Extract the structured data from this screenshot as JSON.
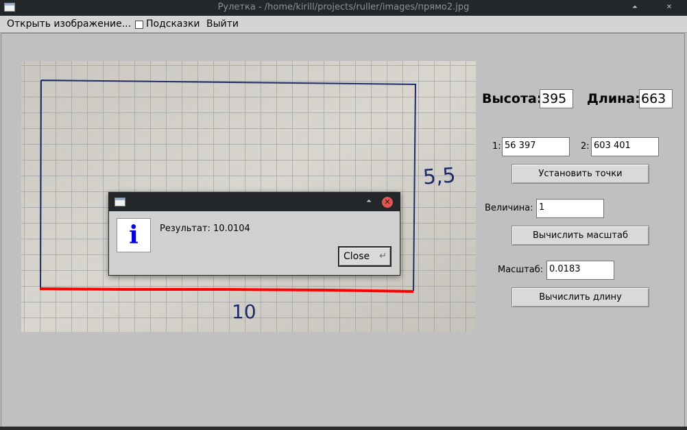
{
  "window": {
    "title": "Рулетка - /home/kirill/projects/ruller/images/прямо2.jpg",
    "maximize_glyph": "⏶",
    "close_glyph": "✕"
  },
  "menubar": {
    "open_image": "Открыть изображение...",
    "hints_label": "Подсказки",
    "hints_checked": false,
    "exit": "Выйти"
  },
  "image_panel": {
    "handwritten_right": "5,5",
    "handwritten_bottom": "10",
    "rect_color": "#1f2a66",
    "measure_line_color": "#ff0000"
  },
  "controls": {
    "height_label": "Высота:",
    "height_value": "395",
    "width_label": "Длина:",
    "width_value": "663",
    "point1_label": "1:",
    "point1_value": "56 397",
    "point2_label": "2:",
    "point2_value": "603 401",
    "set_points_button": "Установить точки",
    "magnitude_label": "Величина:",
    "magnitude_value": "1",
    "compute_scale_button": "Вычислить масштаб",
    "scale_label": "Масштаб:",
    "scale_value": "0.0183",
    "compute_length_button": "Вычислить длину"
  },
  "dialog": {
    "icon_glyph": "i",
    "message": "Результат: 10.0104",
    "close_button": "Close",
    "close_return_glyph": "↵",
    "maximize_glyph": "⏶",
    "close_glyph": "✕"
  }
}
